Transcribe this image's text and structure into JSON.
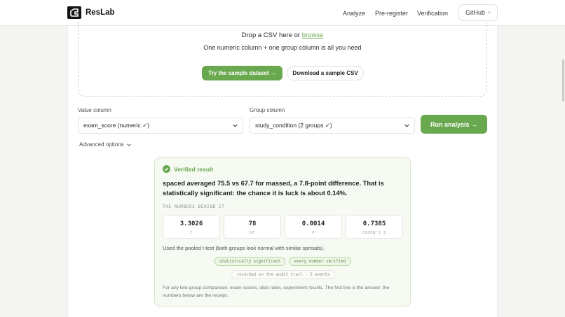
{
  "header": {
    "brand": "ResLab",
    "nav": [
      "Analyze",
      "Pre-register",
      "Verification"
    ],
    "github_label": "GitHub",
    "github_arrow": "↗"
  },
  "upload": {
    "title_prefix": "Drop a CSV here or ",
    "browse_label": "browse",
    "subtitle": "One numeric column + one group column is all you need",
    "sample_button": "Try the sample dataset  →",
    "download_button": "Download a sample CSV"
  },
  "form": {
    "value_label": "Value column",
    "value_selected": "exam_score (numeric ✓)",
    "group_label": "Group column",
    "group_selected": "study_condition (2 groups ✓)",
    "run_button": "Run analysis  →",
    "advanced_label": "Advanced options"
  },
  "result": {
    "status": "Verified result",
    "headline": "spaced averaged 75.5 vs 67.7 for massed, a 7.8-point difference. That is statistically significant: the chance it is luck is about 0.14%.",
    "section_tag": "THE NUMBERS BEHIND IT",
    "stats": [
      {
        "value": "3.3026",
        "label": "T"
      },
      {
        "value": "78",
        "label": "DF"
      },
      {
        "value": "0.0014",
        "label": "P"
      },
      {
        "value": "0.7385",
        "label": "COHEN'S D"
      }
    ],
    "method": "Used the pooled t-test (both groups look normal with similar spreads).",
    "badges": [
      "statistically significant",
      "every number verified"
    ],
    "audit": "recorded on the audit trail · 2 events",
    "footnote": "For any two-group comparison: exam scores, click rates, experiment results. The first line is the answer; the numbers below are the receipt."
  },
  "colors": {
    "accent": "#6aa84f",
    "background": "#f4f4f2"
  }
}
